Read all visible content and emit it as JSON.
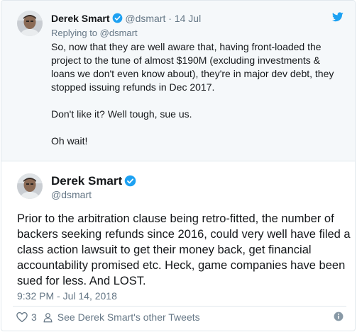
{
  "parent_tweet": {
    "author_name": "Derek Smart",
    "handle": "@dsmart",
    "separator": "·",
    "date": "14 Jul",
    "replying_prefix": "Replying to",
    "replying_to": "@dsmart",
    "paragraphs": [
      "So, now that they are well aware that, having front-loaded the project to the tune of almost $190M (excluding investments & loans we don't even know about), they're in major dev debt, they stopped issuing refunds in Dec 2017.",
      "Don't like it? Well tough, sue us.",
      "Oh wait!"
    ]
  },
  "main_tweet": {
    "author_name": "Derek Smart",
    "handle": "@dsmart",
    "text": "Prior to the arbitration clause being retro-fitted, the number of backers seeking refunds since 2016, could very well have filed a class action lawsuit to get their money back, get financial accountability promised etc. Heck, game companies have been sued for less. And LOST.",
    "timestamp": "9:32 PM - Jul 14, 2018",
    "like_count": "3",
    "other_tweets_link": "See Derek Smart's other Tweets"
  },
  "icons": {
    "verified": "verified-badge-icon",
    "bird": "twitter-bird-icon",
    "like": "heart-icon",
    "profile": "person-icon",
    "info": "info-icon"
  },
  "colors": {
    "twitter_blue": "#1da1f2",
    "muted_text": "#657786",
    "parent_background": "#f5f8fa"
  }
}
